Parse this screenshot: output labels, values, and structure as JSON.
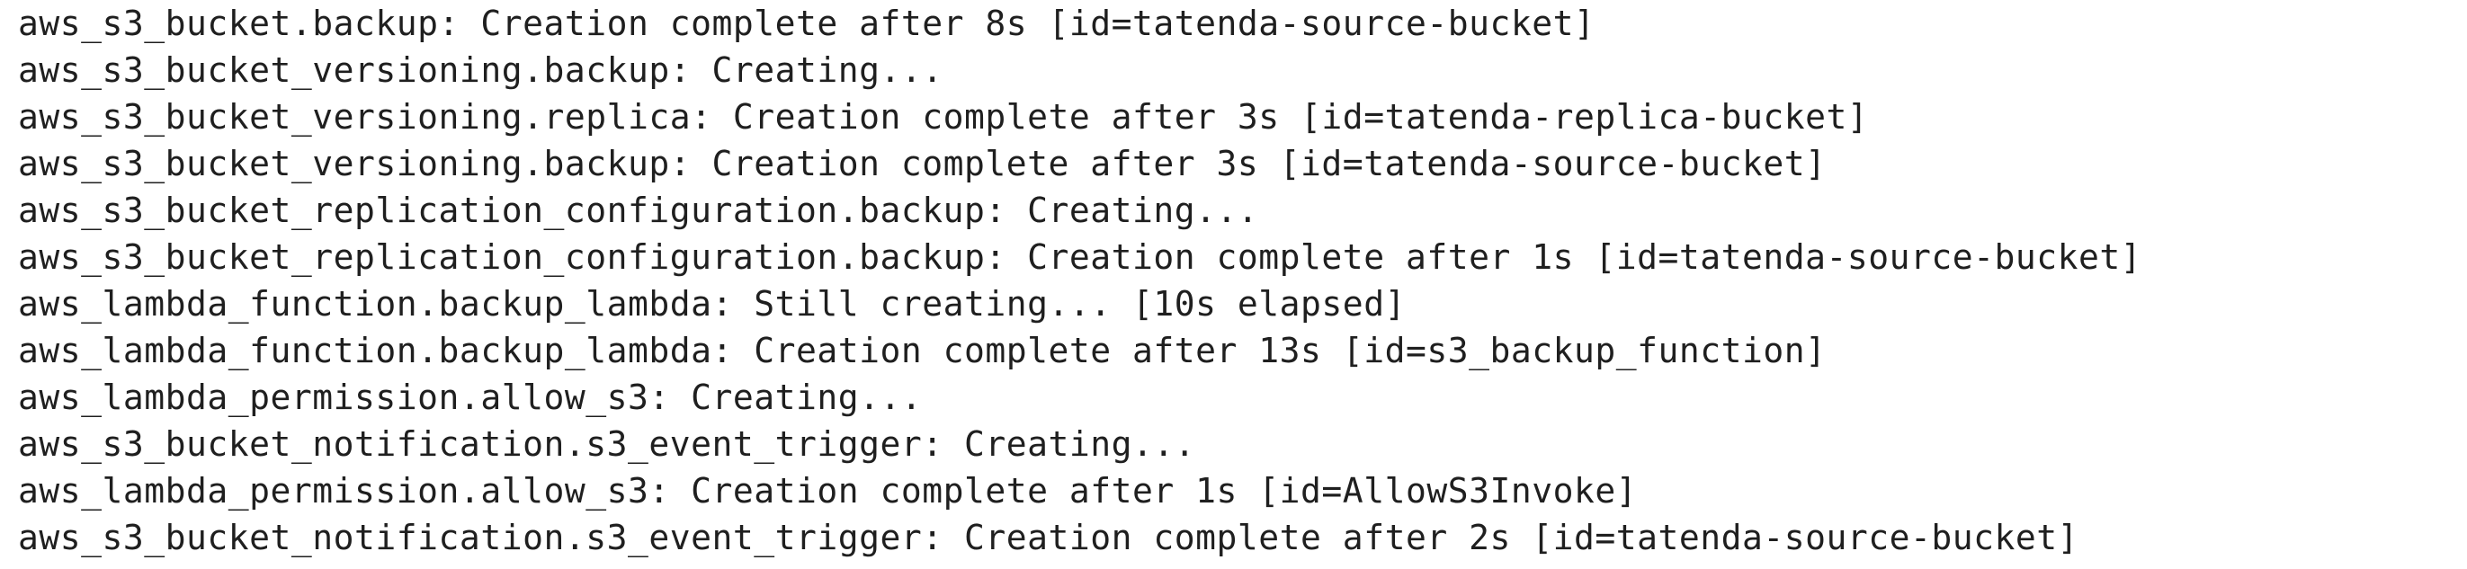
{
  "terminal": {
    "lines": [
      "aws_s3_bucket.backup: Creation complete after 8s [id=tatenda-source-bucket]",
      "aws_s3_bucket_versioning.backup: Creating...",
      "aws_s3_bucket_versioning.replica: Creation complete after 3s [id=tatenda-replica-bucket]",
      "aws_s3_bucket_versioning.backup: Creation complete after 3s [id=tatenda-source-bucket]",
      "aws_s3_bucket_replication_configuration.backup: Creating...",
      "aws_s3_bucket_replication_configuration.backup: Creation complete after 1s [id=tatenda-source-bucket]",
      "aws_lambda_function.backup_lambda: Still creating... [10s elapsed]",
      "aws_lambda_function.backup_lambda: Creation complete after 13s [id=s3_backup_function]",
      "aws_lambda_permission.allow_s3: Creating...",
      "aws_s3_bucket_notification.s3_event_trigger: Creating...",
      "aws_lambda_permission.allow_s3: Creation complete after 1s [id=AllowS3Invoke]",
      "aws_s3_bucket_notification.s3_event_trigger: Creation complete after 2s [id=tatenda-source-bucket]"
    ]
  }
}
